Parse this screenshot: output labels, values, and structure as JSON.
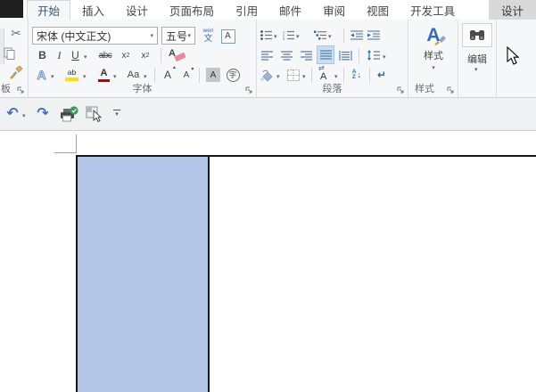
{
  "tabs": {
    "items": [
      "开始",
      "插入",
      "设计",
      "页面布局",
      "引用",
      "邮件",
      "审阅",
      "视图",
      "开发工具"
    ],
    "active": "开始",
    "contextual": "设计"
  },
  "ribbon": {
    "clipboard": {
      "group_label": "板"
    },
    "font": {
      "group_label": "字体",
      "font_name": "宋体 (中文正文)",
      "font_size": "五号",
      "phonetic_top": "wén",
      "phonetic_bottom": "文",
      "char_border": "A",
      "bold": "B",
      "italic": "I",
      "underline": "U",
      "strikethrough": "abc",
      "subscript_base": "x",
      "subscript_mark": "2",
      "superscript_base": "x",
      "superscript_mark": "2",
      "clear_format_letter": "A",
      "text_effects_letter": "A",
      "highlight_letters": "ab",
      "font_color_letter": "A",
      "change_case": "Aa",
      "grow_font_letter": "A",
      "grow_mark": "▲",
      "shrink_font_letter": "A",
      "shrink_mark": "▼",
      "char_shading_letter": "A",
      "enclose_char": "字"
    },
    "paragraph": {
      "group_label": "段落",
      "scale_letter": "A",
      "scale_arrows": "⇄",
      "sort_a": "A",
      "sort_z": "Z",
      "sort_arrow": "↓",
      "show_mark": "↵"
    },
    "styles": {
      "group_label": "样式",
      "button_label": "样式",
      "icon_letter": "A"
    },
    "editing": {
      "button_label": "编辑"
    }
  },
  "qat": {
    "undo_glyph": "↶",
    "redo_glyph": "↷",
    "scissors_glyph": "✂"
  },
  "colors": {
    "accent_blue": "#2e6db5",
    "active_tab_text": "#33597e",
    "selection_fill": "#b3c6e7",
    "highlight_yellow": "#ffe100",
    "font_color_red": "#c00000",
    "eraser_pink": "#e8889a",
    "check_green": "#2e9e5b"
  }
}
